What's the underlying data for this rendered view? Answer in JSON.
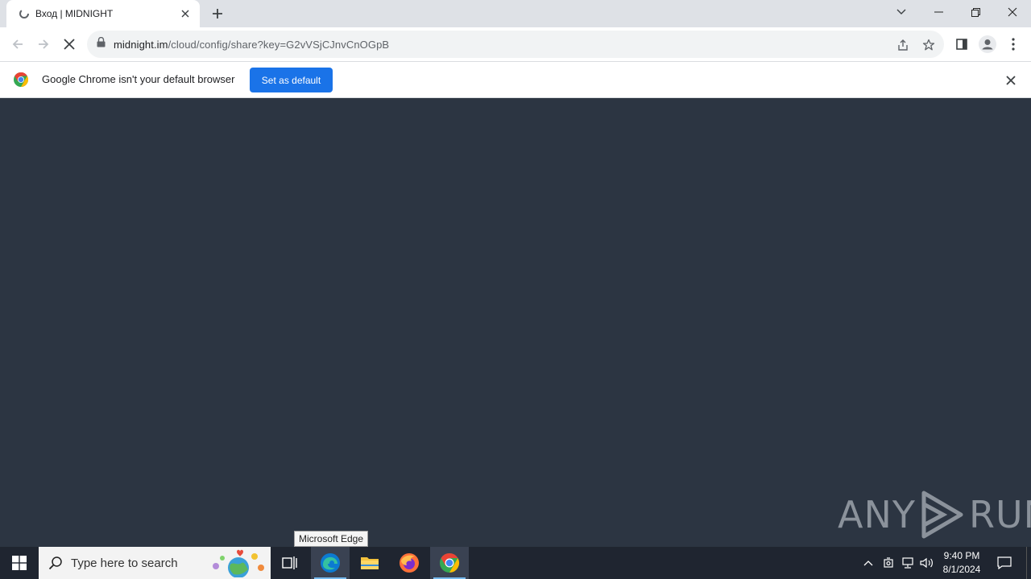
{
  "browser": {
    "tab": {
      "title": "Вход | MIDNIGHT"
    },
    "url": {
      "host": "midnight.im",
      "path": "/cloud/config/share?key=G2vVSjCJnvCnOGpB"
    },
    "infobar": {
      "message": "Google Chrome isn't your default browser",
      "button_label": "Set as default"
    }
  },
  "watermark": {
    "left": "ANY",
    "right": "RUN"
  },
  "tooltip": {
    "text": "Microsoft Edge"
  },
  "taskbar": {
    "search_placeholder": "Type here to search",
    "clock": {
      "time": "9:40 PM",
      "date": "8/1/2024"
    }
  },
  "colors": {
    "page_bg": "#2c3542",
    "accent": "#1a73e8",
    "taskbar": "#1f2530"
  }
}
